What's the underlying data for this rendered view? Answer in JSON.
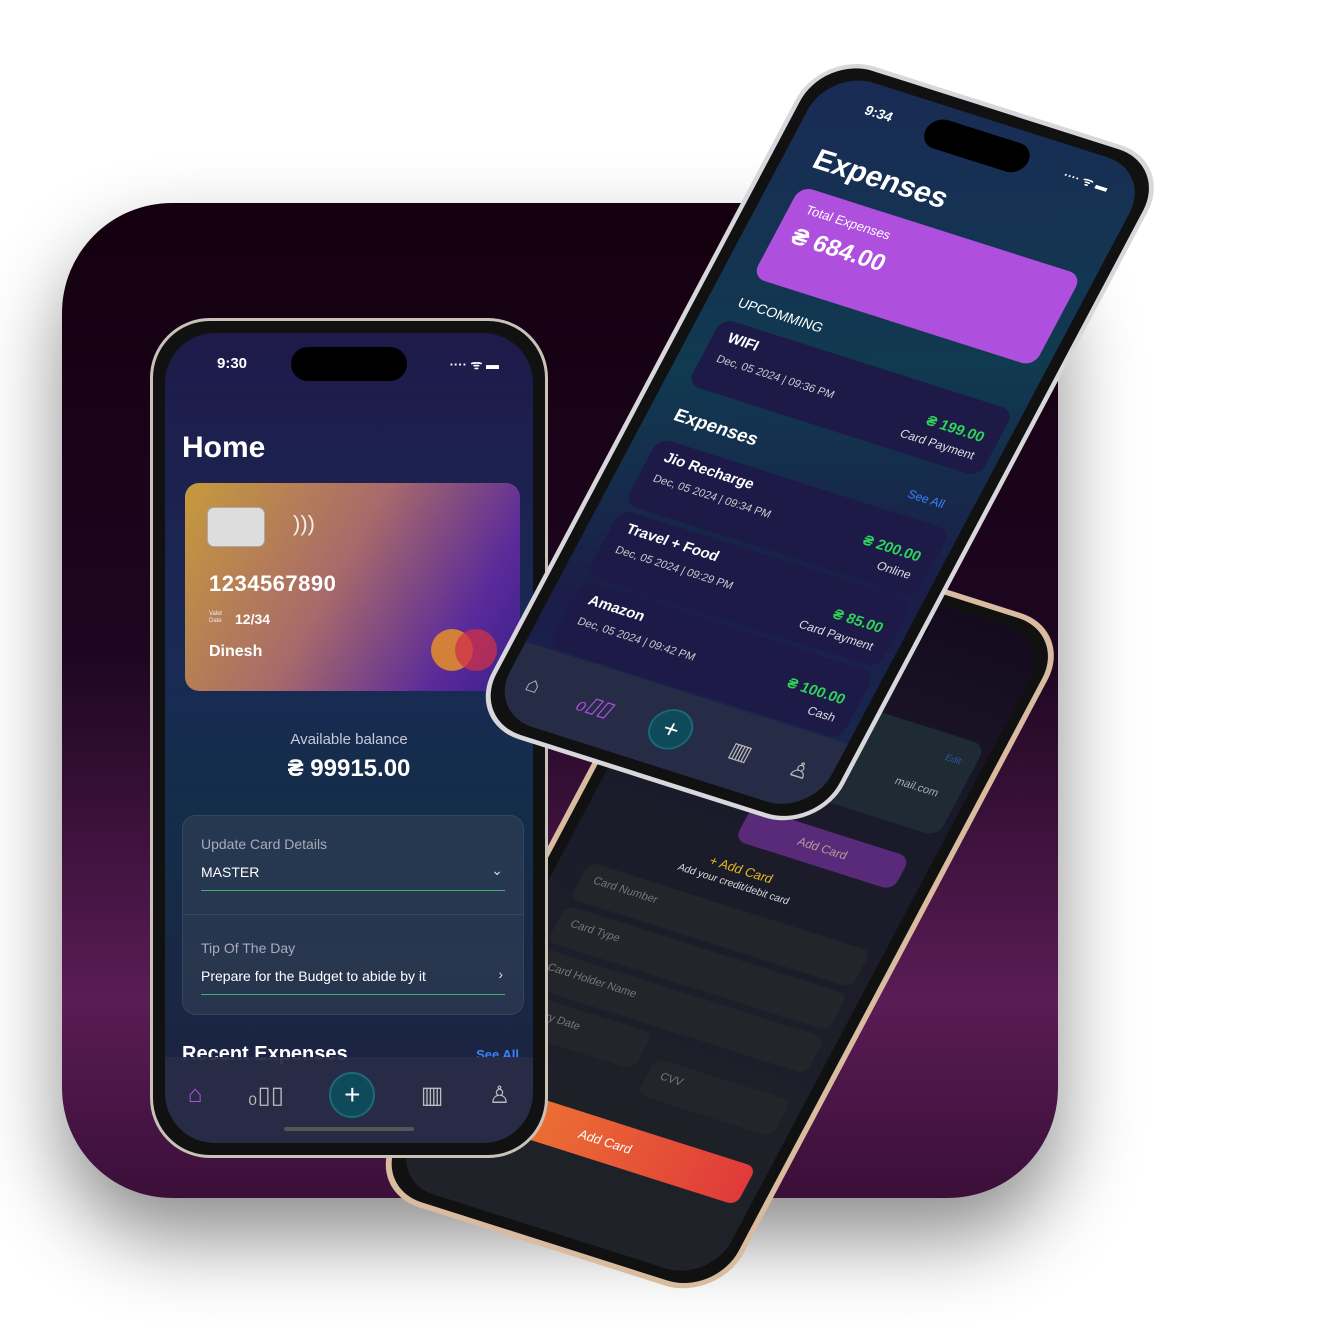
{
  "home_phone": {
    "status_time": "9:30",
    "title": "Home",
    "card": {
      "number": "1234567890",
      "valid_label": "Valid Date",
      "valid_date": "12/34",
      "holder": "Dinesh"
    },
    "available_label": "Available balance",
    "balance": "₴ 99915.00",
    "update_card": {
      "label": "Update Card Details",
      "value": "MASTER"
    },
    "tip": {
      "label": "Tip Of The Day",
      "text": "Prepare for the Budget to abide by it"
    },
    "recent_title": "Recent Expenses",
    "see_all": "See All"
  },
  "expenses_phone": {
    "status_time": "9:34",
    "title": "Expenses",
    "total_label": "Total Expenses",
    "total": "₴ 684.00",
    "upcoming_label": "UPCOMMING",
    "upcoming": [
      {
        "name": "WIFI",
        "date": "Dec, 05 2024 | 09:36 PM",
        "amount": "₴ 199.00",
        "method": "Card Payment"
      }
    ],
    "section": "Expenses",
    "see_all": "See All",
    "items": [
      {
        "name": "Jio Recharge",
        "date": "Dec, 05 2024 | 09:34 PM",
        "amount": "₴ 200.00",
        "method": "Online"
      },
      {
        "name": "Travel + Food",
        "date": "Dec, 05 2024 | 09:29 PM",
        "amount": "₴ 85.00",
        "method": "Card Payment"
      },
      {
        "name": "Amazon",
        "date": "Dec, 05 2024 | 09:42 PM",
        "amount": "₴ 100.00",
        "method": "Cash"
      }
    ]
  },
  "card_phone": {
    "email": "mail.com",
    "edit": "Edit",
    "add_card_button": "Add Card",
    "form_title": "+ Add Card",
    "form_subtitle": "Add your credit/debit card",
    "fields": [
      "Card Number",
      "Card Type",
      "Card Holder Name",
      "Expiry Date",
      "CVV"
    ],
    "submit": "Add Card"
  }
}
